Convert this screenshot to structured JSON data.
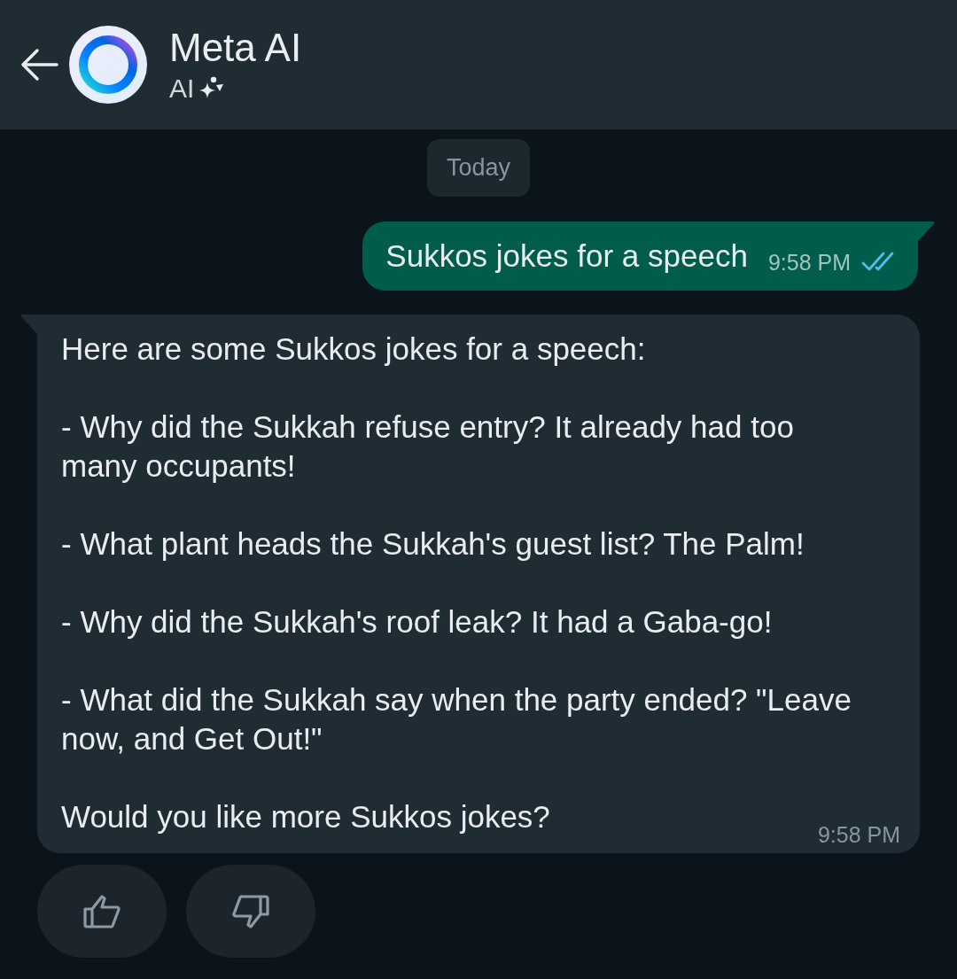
{
  "header": {
    "title": "Meta AI",
    "subtitle": "AI"
  },
  "date_chip": "Today",
  "messages": [
    {
      "kind": "outgoing",
      "paragraphs": [
        "Sukkos jokes for a speech"
      ],
      "time": "9:58 PM",
      "read": true
    },
    {
      "kind": "incoming",
      "paragraphs": [
        "Here are some Sukkos jokes for a speech:",
        "- Why did the Sukkah refuse entry? It already had too many occupants!",
        "- What plant heads the Sukkah's guest list? The Palm!",
        "- Why did the Sukkah's roof leak? It had a Gaba-go!",
        "- What did the Sukkah say when the party ended? \"Leave now, and Get Out!\"",
        "Would you like more Sukkos jokes?"
      ],
      "time": "9:58 PM"
    }
  ]
}
